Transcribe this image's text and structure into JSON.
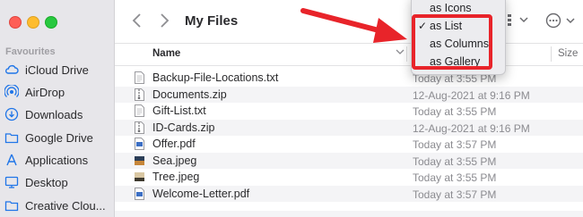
{
  "window": {
    "title": "My Files"
  },
  "sidebar": {
    "heading": "Favourites",
    "items": [
      {
        "label": "iCloud Drive",
        "icon": "cloud-icon"
      },
      {
        "label": "AirDrop",
        "icon": "airdrop-icon"
      },
      {
        "label": "Downloads",
        "icon": "download-icon"
      },
      {
        "label": "Google Drive",
        "icon": "folder-icon"
      },
      {
        "label": "Applications",
        "icon": "applications-icon"
      },
      {
        "label": "Desktop",
        "icon": "desktop-icon"
      },
      {
        "label": "Creative Clou...",
        "icon": "folder-icon"
      }
    ]
  },
  "columns": {
    "name": "Name",
    "size": "Size"
  },
  "files": [
    {
      "name": "Backup-File-Locations.txt",
      "date": "Today at 3:55 PM",
      "icon": "text-file-icon"
    },
    {
      "name": "Documents.zip",
      "date": "12-Aug-2021 at 9:16 PM",
      "icon": "zip-file-icon"
    },
    {
      "name": "Gift-List.txt",
      "date": "Today at 3:55 PM",
      "icon": "text-file-icon"
    },
    {
      "name": "ID-Cards.zip",
      "date": "12-Aug-2021 at 9:16 PM",
      "icon": "zip-file-icon"
    },
    {
      "name": "Offer.pdf",
      "date": "Today at 3:57 PM",
      "icon": "pdf-file-icon"
    },
    {
      "name": "Sea.jpeg",
      "date": "Today at 3:55 PM",
      "icon": "image-file-icon"
    },
    {
      "name": "Tree.jpeg",
      "date": "Today at 3:55 PM",
      "icon": "image-file-icon"
    },
    {
      "name": "Welcome-Letter.pdf",
      "date": "Today at 3:57 PM",
      "icon": "pdf-file-icon"
    }
  ],
  "view_menu": {
    "items": [
      "as Icons",
      "as List",
      "as Columns",
      "as Gallery"
    ],
    "checked": "as List",
    "check_mark": "✓"
  },
  "colors": {
    "annotation_red": "#e8242a",
    "sidebar_accent": "#1f75e8"
  }
}
